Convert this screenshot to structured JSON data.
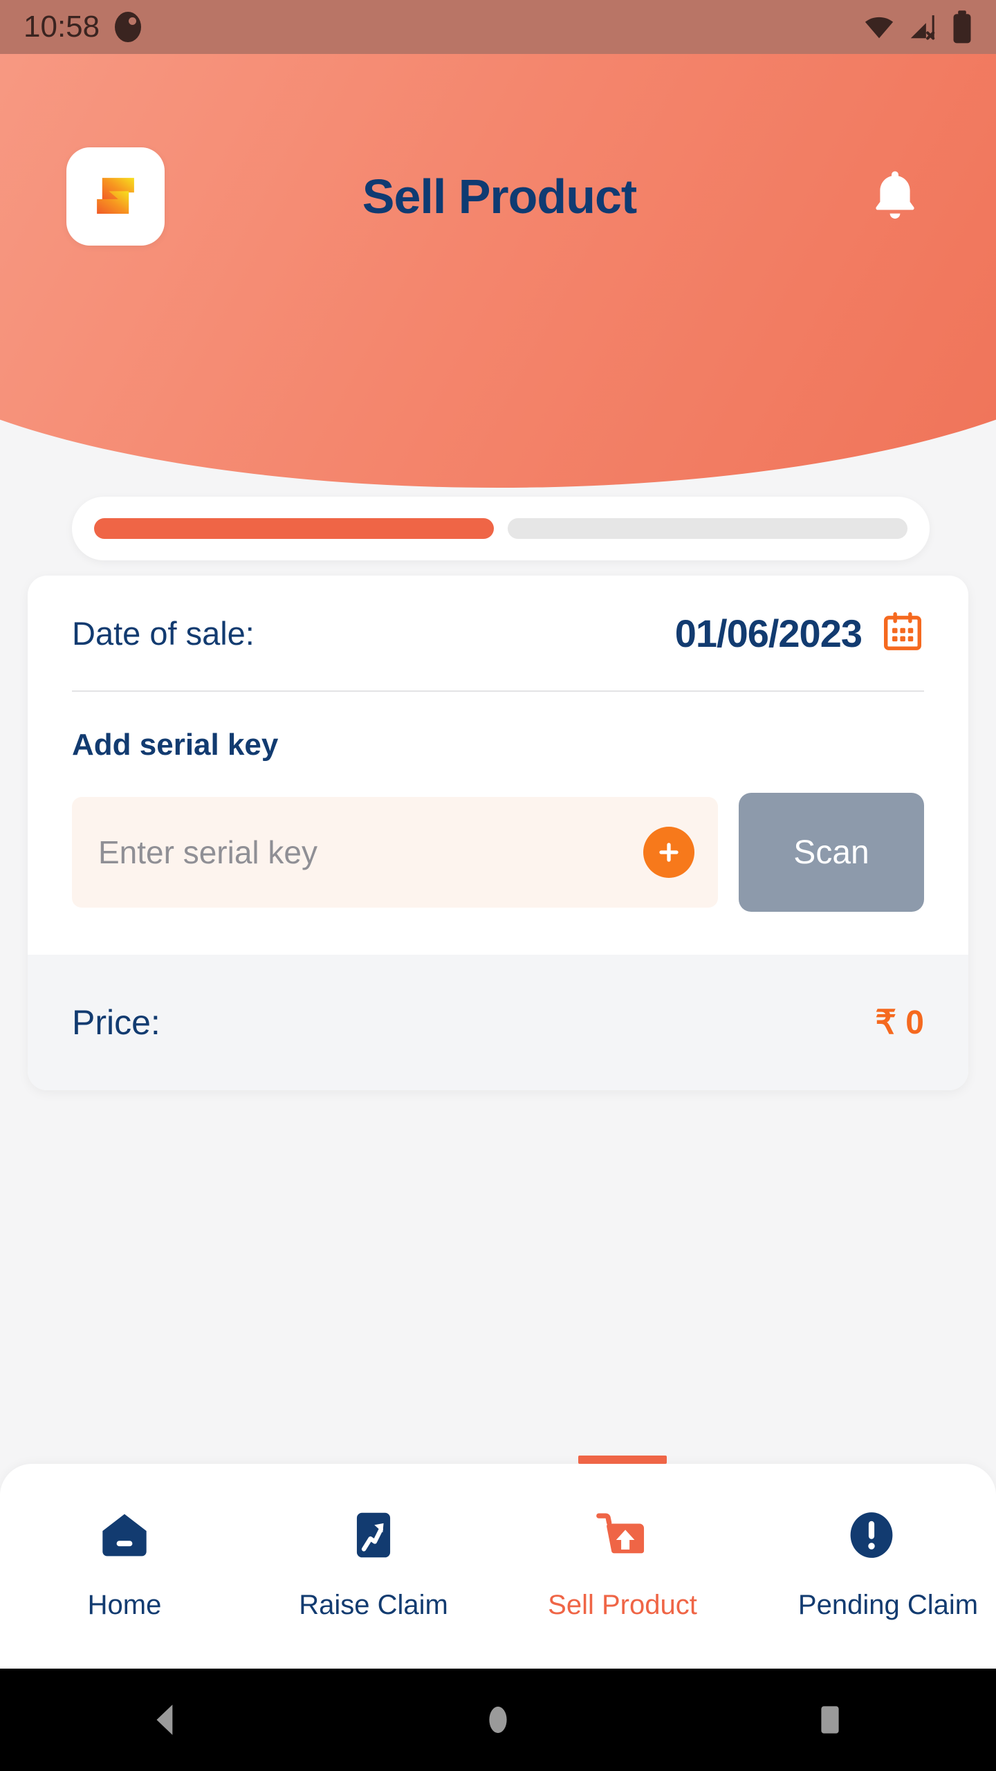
{
  "status_bar": {
    "time": "10:58",
    "icons": [
      "notification-dot-icon",
      "wifi-icon",
      "cellular-off-icon",
      "battery-full-icon"
    ]
  },
  "header": {
    "title": "Sell Product",
    "logo_name": "app-logo-s",
    "bell_name": "notification-bell-icon",
    "gradient_from": "#f89e88",
    "gradient_to": "#ef7055"
  },
  "progress": {
    "total_steps": 2,
    "completed_steps": 1,
    "fill_color": "#ef6546",
    "track_color": "#e6e6e6"
  },
  "form": {
    "date_label": "Date of sale:",
    "date_value": "01/06/2023",
    "calendar_icon": "calendar-icon",
    "serial_section_label": "Add serial key",
    "serial_placeholder": "Enter serial key",
    "serial_value": "",
    "add_button_label": "+",
    "scan_button_label": "Scan",
    "scan_button_color": "#8d9aab",
    "price_label": "Price:",
    "price_value": "₹ 0",
    "price_color": "#f5691f"
  },
  "bottom_nav": {
    "active_index": 2,
    "active_color": "#ef6546",
    "inactive_color": "#123b70",
    "items": [
      {
        "label": "Home",
        "icon": "home-icon"
      },
      {
        "label": "Raise Claim",
        "icon": "growth-arrow-icon"
      },
      {
        "label": "Sell Product",
        "icon": "cart-upload-icon"
      },
      {
        "label": "Pending Claim",
        "icon": "exclamation-circle-icon"
      }
    ]
  },
  "android_nav": {
    "back": "back-triangle-icon",
    "home": "home-circle-icon",
    "recents": "recents-square-icon"
  }
}
